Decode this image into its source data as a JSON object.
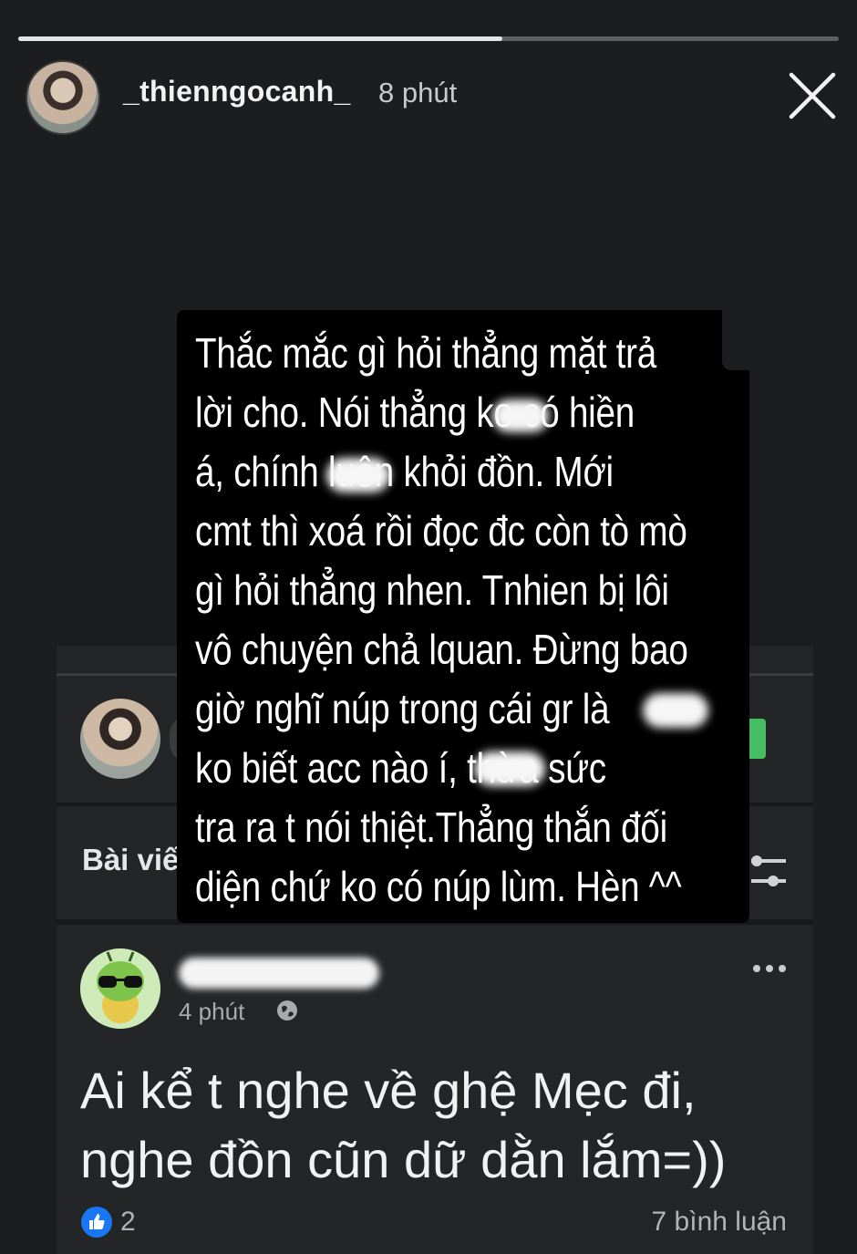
{
  "story": {
    "progress_fraction": 0.59,
    "username": "_thienngocanh_",
    "time_ago": "8 phút"
  },
  "overlay_text": {
    "lines": [
      "Thắc mắc gì hỏi thẳng mặt trả",
      "lời cho. Nói thẳng      ko có hiền",
      "á, chính      luôn khỏi đồn. Mới",
      "cmt thì xoá rồi đọc đc còn tò mò",
      "gì hỏi thẳng nhen. Tnhien bị lôi",
      "vô chuyện chả lquan. Đừng bao",
      "giờ nghĩ núp trong cái gr là",
      "ko biết acc nào í,       thừa sức",
      "tra ra t nói thiệt.Thẳng thắn đối",
      "diện chứ ko có núp lùm. Hèn ^^"
    ]
  },
  "fb": {
    "section_title": "Bài viế",
    "post": {
      "time": "4 phút",
      "text_line1": "Ai kể t nghe về ghệ Mẹc đi,",
      "text_line2": "nghe đồn cũn dữ dằn lắm=))",
      "likes": "2",
      "comments": "7 bình luận"
    }
  },
  "colors": {
    "background": "#1c1d1f",
    "overlay": "#000000",
    "like_blue": "#1877f2"
  },
  "icons": [
    "close-icon",
    "photo-icon",
    "filter-icon",
    "more-icon",
    "globe-icon",
    "like-icon"
  ]
}
